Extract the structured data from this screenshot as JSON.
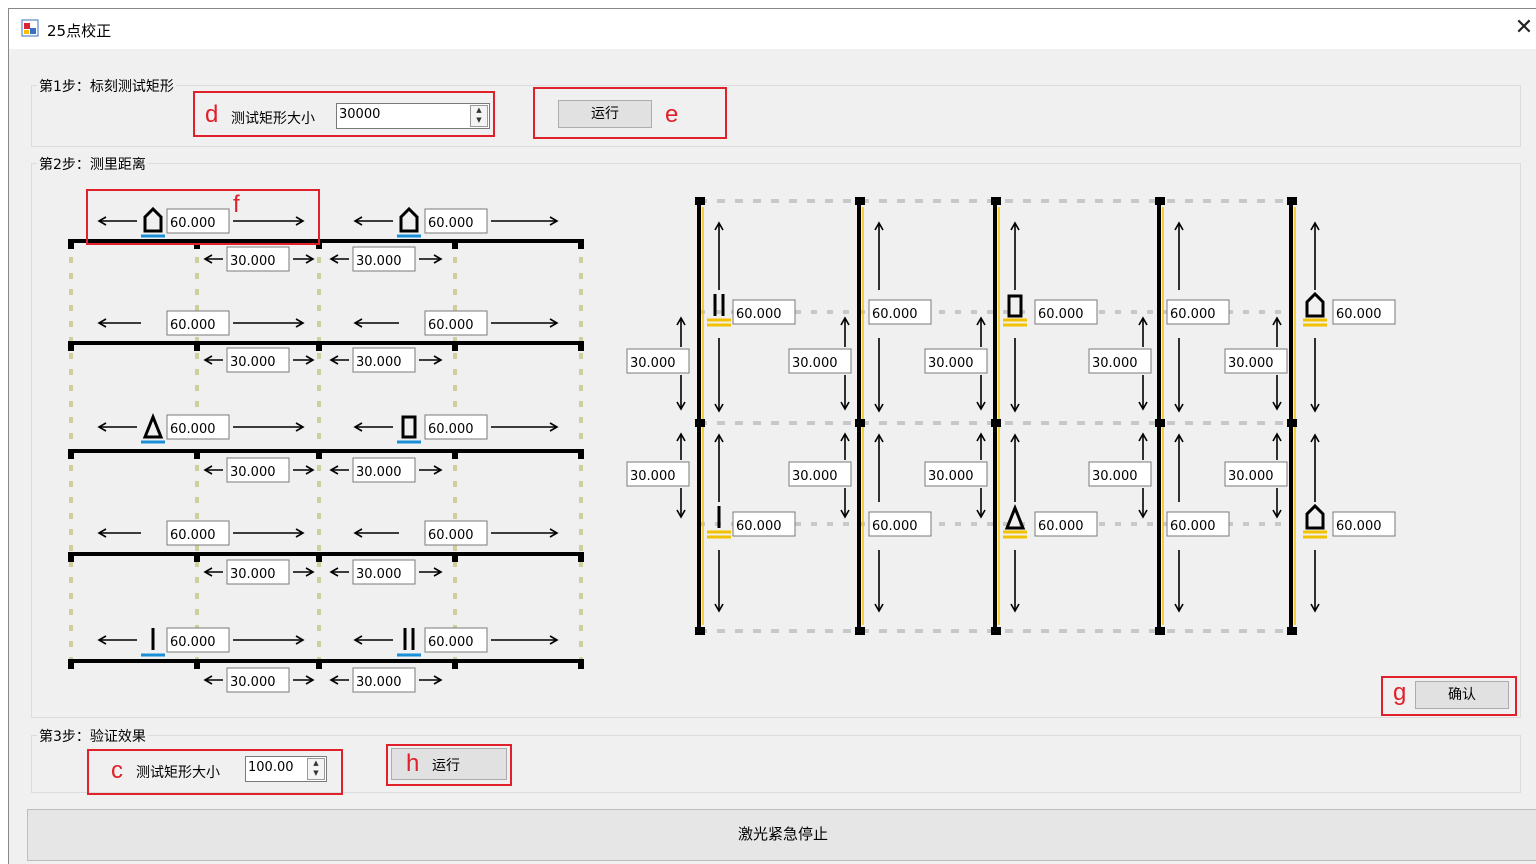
{
  "window": {
    "title": "25点校正",
    "close_glyph": "✕"
  },
  "step1": {
    "label": "第1步：标刻测试矩形",
    "size_label": "测试矩形大小",
    "size_value": "30000",
    "run_label": "运行"
  },
  "step2": {
    "label": "第2步：测里距离",
    "confirm_label": "确认"
  },
  "step3": {
    "label": "第3步：验证效果",
    "size_label": "测试矩形大小",
    "size_value": "100.00",
    "run_label": "运行"
  },
  "emergency_stop": "激光紧急停止",
  "annotations": {
    "c": "c",
    "d": "d",
    "e": "e",
    "f": "f",
    "g": "g",
    "h": "h"
  },
  "left_grid": {
    "long_values": [
      "60.000",
      "60.000",
      "60.000",
      "60.000",
      "60.000",
      "60.000",
      "60.000",
      "60.000",
      "60.000",
      "60.000"
    ],
    "short_values": [
      "30.000",
      "30.000",
      "30.000",
      "30.000",
      "30.000",
      "30.000",
      "30.000",
      "30.000",
      "30.000",
      "30.000"
    ]
  },
  "right_grid": {
    "long_values": [
      "60.000",
      "60.000",
      "60.000",
      "60.000",
      "60.000",
      "60.000",
      "60.000",
      "60.000",
      "60.000",
      "60.000"
    ],
    "short_values": [
      "30.000",
      "30.000",
      "30.000",
      "30.000",
      "30.000",
      "30.000",
      "30.000",
      "30.000",
      "30.000",
      "30.000"
    ]
  },
  "colors": {
    "annotation": "#e0202a",
    "probe_blue": "#1a8fd8",
    "probe_yellow": "#f2c200"
  },
  "icons": [
    "window-app-icon",
    "close-icon",
    "spin-up-icon",
    "spin-down-icon",
    "probe-marker-icon",
    "arrow-icon"
  ]
}
